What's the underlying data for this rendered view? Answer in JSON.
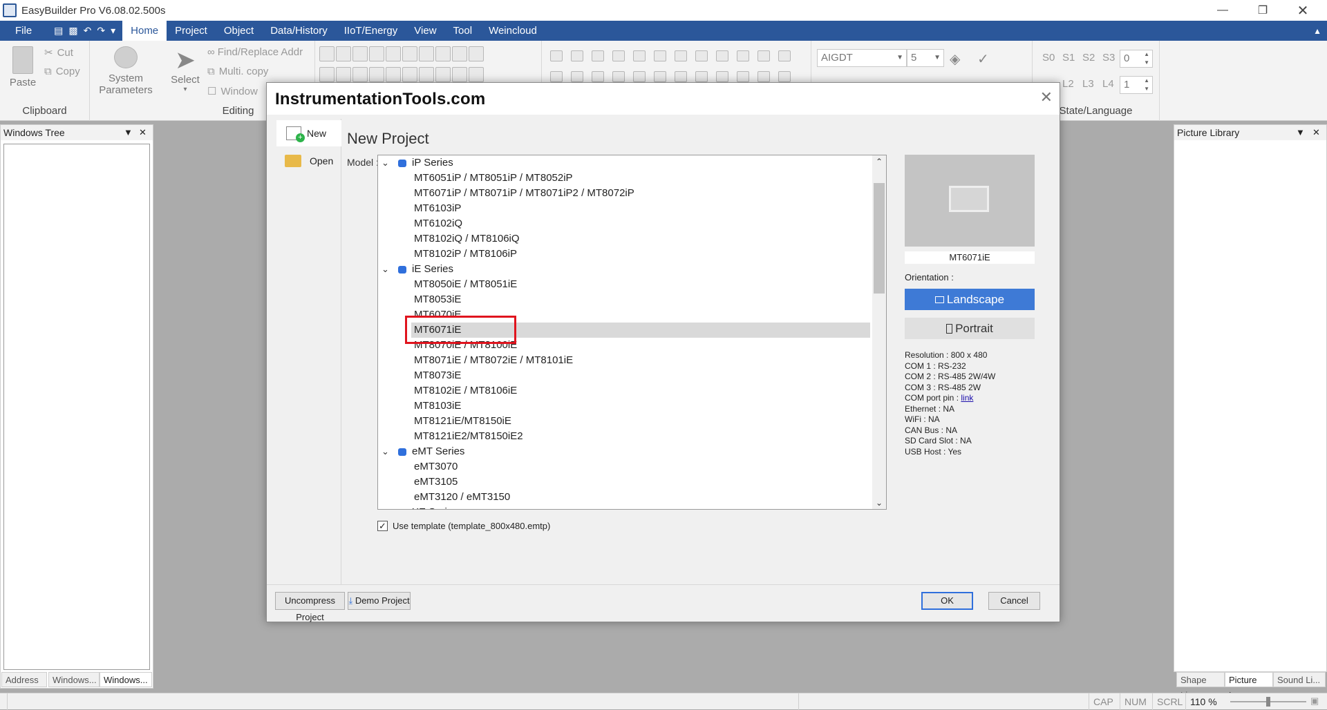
{
  "app": {
    "title": "EasyBuilder Pro V6.08.02.500s"
  },
  "menu": [
    "File",
    "Home",
    "Project",
    "Object",
    "Data/History",
    "IIoT/Energy",
    "View",
    "Tool",
    "Weincloud"
  ],
  "ribbon": {
    "paste": "Paste",
    "cut": "Cut",
    "copy": "Copy",
    "clipboard": "Clipboard",
    "system_parameters_1": "System",
    "system_parameters_2": "Parameters",
    "select": "Select",
    "find_replace": "Find/Replace Addr",
    "multi_copy": "Multi. copy",
    "window": "Window",
    "editing": "Editing",
    "font": "AIGDT",
    "font_size": "5",
    "state_labels": [
      "S0",
      "S1",
      "S2",
      "S3"
    ],
    "state_value": "0",
    "lang_labels": [
      "L2",
      "L3",
      "L4"
    ],
    "lang_value": "1",
    "state_language": "State/Language"
  },
  "panels": {
    "windows_tree": "Windows Tree",
    "picture_library": "Picture Library",
    "left_tabs": [
      "Address",
      "Windows...",
      "Windows..."
    ],
    "right_tabs": [
      "Shape Li...",
      "Picture L...",
      "Sound Li..."
    ]
  },
  "status": {
    "cap": "CAP",
    "num": "NUM",
    "scrl": "SCRL",
    "zoom": "110 %"
  },
  "dialog": {
    "watermark": "InstrumentationTools.com",
    "nav_new": "New",
    "nav_open": "Open",
    "title": "New Project",
    "model_label": "Model :",
    "tree": [
      {
        "type": "series",
        "label": "iP Series"
      },
      {
        "type": "model",
        "label": "MT6051iP / MT8051iP / MT8052iP"
      },
      {
        "type": "model",
        "label": "MT6071iP / MT8071iP / MT8071iP2 / MT8072iP"
      },
      {
        "type": "model",
        "label": "MT6103iP"
      },
      {
        "type": "model",
        "label": "MT6102iQ"
      },
      {
        "type": "model",
        "label": "MT8102iQ / MT8106iQ"
      },
      {
        "type": "model",
        "label": "MT8102iP / MT8106iP"
      },
      {
        "type": "series",
        "label": "iE Series"
      },
      {
        "type": "model",
        "label": "MT8050iE / MT8051iE"
      },
      {
        "type": "model",
        "label": "MT8053iE"
      },
      {
        "type": "model",
        "label": "MT6070iE"
      },
      {
        "type": "model",
        "label": "MT6071iE",
        "selected": true
      },
      {
        "type": "model",
        "label": "MT8070iE / MT8100iE"
      },
      {
        "type": "model",
        "label": "MT8071iE / MT8072iE / MT8101iE"
      },
      {
        "type": "model",
        "label": "MT8073iE"
      },
      {
        "type": "model",
        "label": "MT8102iE / MT8106iE"
      },
      {
        "type": "model",
        "label": "MT8103iE"
      },
      {
        "type": "model",
        "label": "MT8121iE/MT8150iE"
      },
      {
        "type": "model",
        "label": "MT8121iE2/MT8150iE2"
      },
      {
        "type": "series",
        "label": "eMT Series"
      },
      {
        "type": "model",
        "label": "eMT3070"
      },
      {
        "type": "model",
        "label": "eMT3105"
      },
      {
        "type": "model",
        "label": "eMT3120 / eMT3150"
      },
      {
        "type": "series",
        "label": "XE Series"
      }
    ],
    "use_template": "Use template (template_800x480.emtp)",
    "selected_model": "MT6071iE",
    "orientation_label": "Orientation :",
    "landscape": "Landscape",
    "portrait": "Portrait",
    "specs": {
      "resolution": "Resolution : 800 x 480",
      "com1": "COM 1 : RS-232",
      "com2": "COM 2 : RS-485 2W/4W",
      "com3": "COM 3 : RS-485 2W",
      "com_pin_label": "COM port pin :",
      "com_pin_link": "link",
      "ethernet": "Ethernet : NA",
      "wifi": "WiFi : NA",
      "can": "CAN Bus : NA",
      "sd": "SD Card Slot : NA",
      "usb": "USB Host : Yes"
    },
    "uncompress": "Uncompress Project",
    "demo": "Demo Project",
    "ok": "OK",
    "cancel": "Cancel"
  }
}
